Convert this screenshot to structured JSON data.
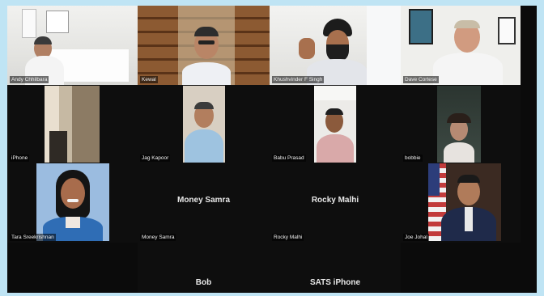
{
  "participants": [
    {
      "name": "Andy Chhilbara"
    },
    {
      "name": "Kewal"
    },
    {
      "name": "Khushvinder F Singh"
    },
    {
      "name": "Dave Cortese"
    },
    {
      "name": "iPhone"
    },
    {
      "name": "Jag Kapoor"
    },
    {
      "name": "Babu Prasad"
    },
    {
      "name": "bobbie"
    },
    {
      "name": "Tara Sreekrishnan"
    },
    {
      "name": "Money Samra"
    },
    {
      "name": "Rocky Malhi"
    },
    {
      "name": "Joe Johal"
    },
    {
      "name": "Bob"
    },
    {
      "name": "SATS iPhone"
    }
  ]
}
